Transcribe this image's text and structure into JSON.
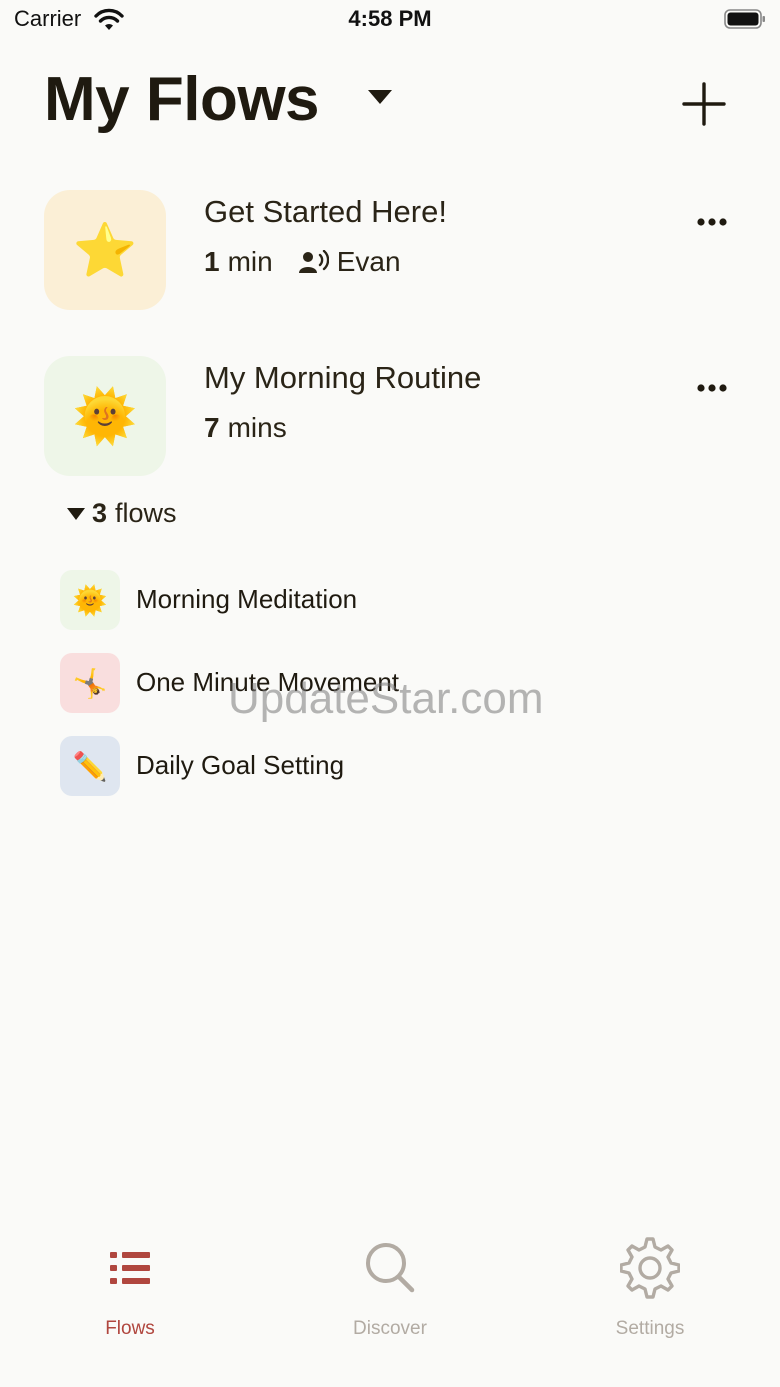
{
  "status_bar": {
    "carrier": "Carrier",
    "time": "4:58 PM"
  },
  "header": {
    "title": "My Flows"
  },
  "flows": [
    {
      "title": "Get Started Here!",
      "duration_num": "1",
      "duration_unit": "min",
      "voice": "Evan",
      "emoji": "⭐",
      "thumb_color": "#fbefd6"
    },
    {
      "title": "My Morning Routine",
      "duration_num": "7",
      "duration_unit": "mins",
      "emoji": "🌞",
      "thumb_color": "#eef6e8"
    }
  ],
  "sub_flows": {
    "count": "3",
    "label": "flows",
    "items": [
      {
        "label": "Morning Meditation",
        "emoji": "🌞",
        "thumb_color": "#eef6e8"
      },
      {
        "label": "One Minute Movement",
        "emoji": "🤸",
        "thumb_color": "#f9dede"
      },
      {
        "label": "Daily Goal Setting",
        "emoji": "✏️",
        "thumb_color": "#dfe6f0"
      }
    ]
  },
  "watermark": "UpdateStar.com",
  "tab_bar": {
    "active_color": "#b0463e",
    "inactive_color": "#b2aba3",
    "tabs": [
      {
        "label": "Flows",
        "icon": "list-icon",
        "active": true
      },
      {
        "label": "Discover",
        "icon": "search-icon",
        "active": false
      },
      {
        "label": "Settings",
        "icon": "gear-icon",
        "active": false
      }
    ]
  }
}
